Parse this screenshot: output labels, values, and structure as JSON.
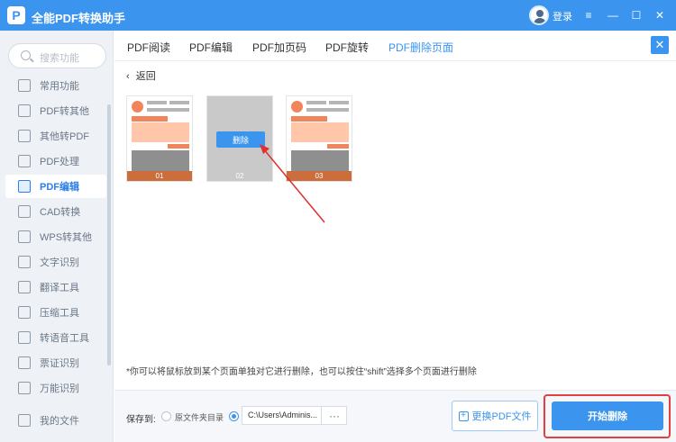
{
  "app": {
    "title": "全能PDF转换助手",
    "logo_glyph": "P"
  },
  "header": {
    "login": "登录",
    "menu_icon": "≡",
    "min_icon": "—",
    "max_icon": "☐",
    "close_icon": "✕"
  },
  "sidebar": {
    "search_placeholder": "搜索功能",
    "items": [
      {
        "label": "常用功能",
        "icon": "star-icon"
      },
      {
        "label": "PDF转其他",
        "icon": "pdf-convert-icon"
      },
      {
        "label": "其他转PDF",
        "icon": "to-pdf-icon"
      },
      {
        "label": "PDF处理",
        "icon": "pdf-process-icon"
      },
      {
        "label": "PDF编辑",
        "icon": "pdf-edit-icon",
        "active": true
      },
      {
        "label": "CAD转换",
        "icon": "cad-icon"
      },
      {
        "label": "WPS转其他",
        "icon": "wps-icon"
      },
      {
        "label": "文字识别",
        "icon": "ocr-icon"
      },
      {
        "label": "翻译工具",
        "icon": "translate-icon"
      },
      {
        "label": "压缩工具",
        "icon": "compress-icon"
      },
      {
        "label": "转语音工具",
        "icon": "voice-icon"
      },
      {
        "label": "票证识别",
        "icon": "ticket-icon"
      },
      {
        "label": "万能识别",
        "icon": "scan-icon"
      },
      {
        "label": "我的文件",
        "icon": "folder-icon"
      }
    ]
  },
  "tabs": [
    {
      "label": "PDF阅读"
    },
    {
      "label": "PDF编辑"
    },
    {
      "label": "PDF加页码"
    },
    {
      "label": "PDF旋转"
    },
    {
      "label": "PDF删除页面",
      "active": true
    }
  ],
  "close_panel_icon": "✕",
  "back": {
    "arrow": "‹",
    "label": "返回"
  },
  "pages": [
    {
      "number": "01"
    },
    {
      "number": "02",
      "hover": true,
      "delete_label": "删除"
    },
    {
      "number": "03"
    }
  ],
  "tip": "*你可以将鼠标放到某个页面单独对它进行删除，也可以按住“shift”选择多个页面进行删除",
  "save": {
    "label": "保存到:",
    "option_source": "原文件夹目录",
    "path": "C:\\Users\\Adminis...",
    "dots": "···"
  },
  "buttons": {
    "replace": "更换PDF文件",
    "replace_icon": "+",
    "start": "开始删除"
  },
  "colors": {
    "accent": "#3b95ee",
    "highlight_box": "#e04040",
    "page_orange": "#f0845b",
    "page_peach": "#ffc6aa"
  }
}
